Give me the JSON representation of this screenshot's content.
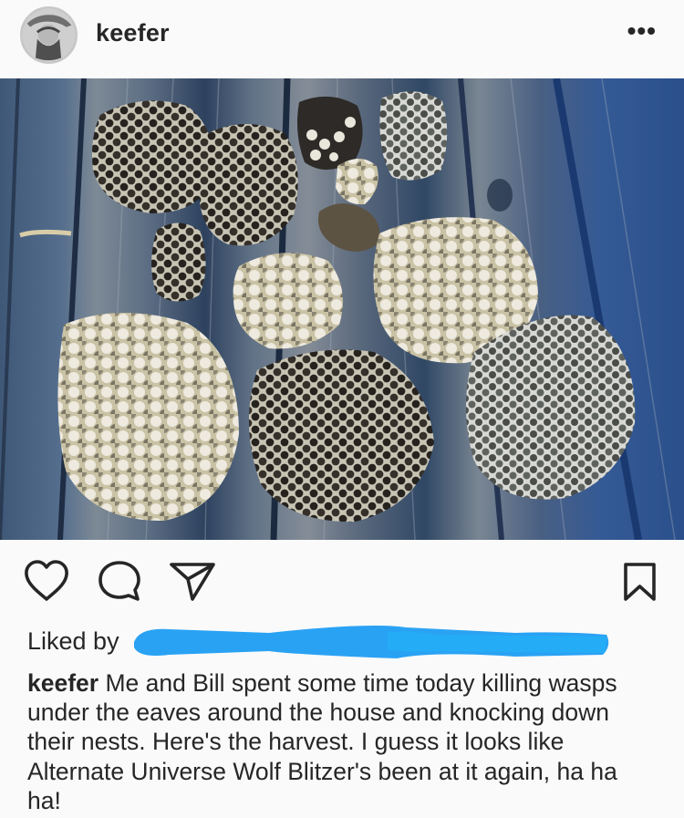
{
  "header": {
    "username": "keefer",
    "more_glyph": "•••",
    "avatar_icon": "avatar-icon"
  },
  "photo": {
    "subject_icon": "photo-wasp-nests"
  },
  "actions": {
    "icons": [
      "heart-icon",
      "comment-icon",
      "share-icon",
      "bookmark-icon"
    ]
  },
  "likes": {
    "label": "Liked by",
    "redaction_color": "#2aa2f4"
  },
  "caption": {
    "username": "keefer",
    "text": "Me and Bill spent some time today killing wasps under the eaves around the house and knocking down their nests. Here's the harvest. I guess it looks like Alternate Universe Wolf Blitzer's been at it again, ha ha ha!"
  },
  "colors": {
    "text": "#262626",
    "background": "#fafafa",
    "redaction": "#2aa2f4"
  }
}
